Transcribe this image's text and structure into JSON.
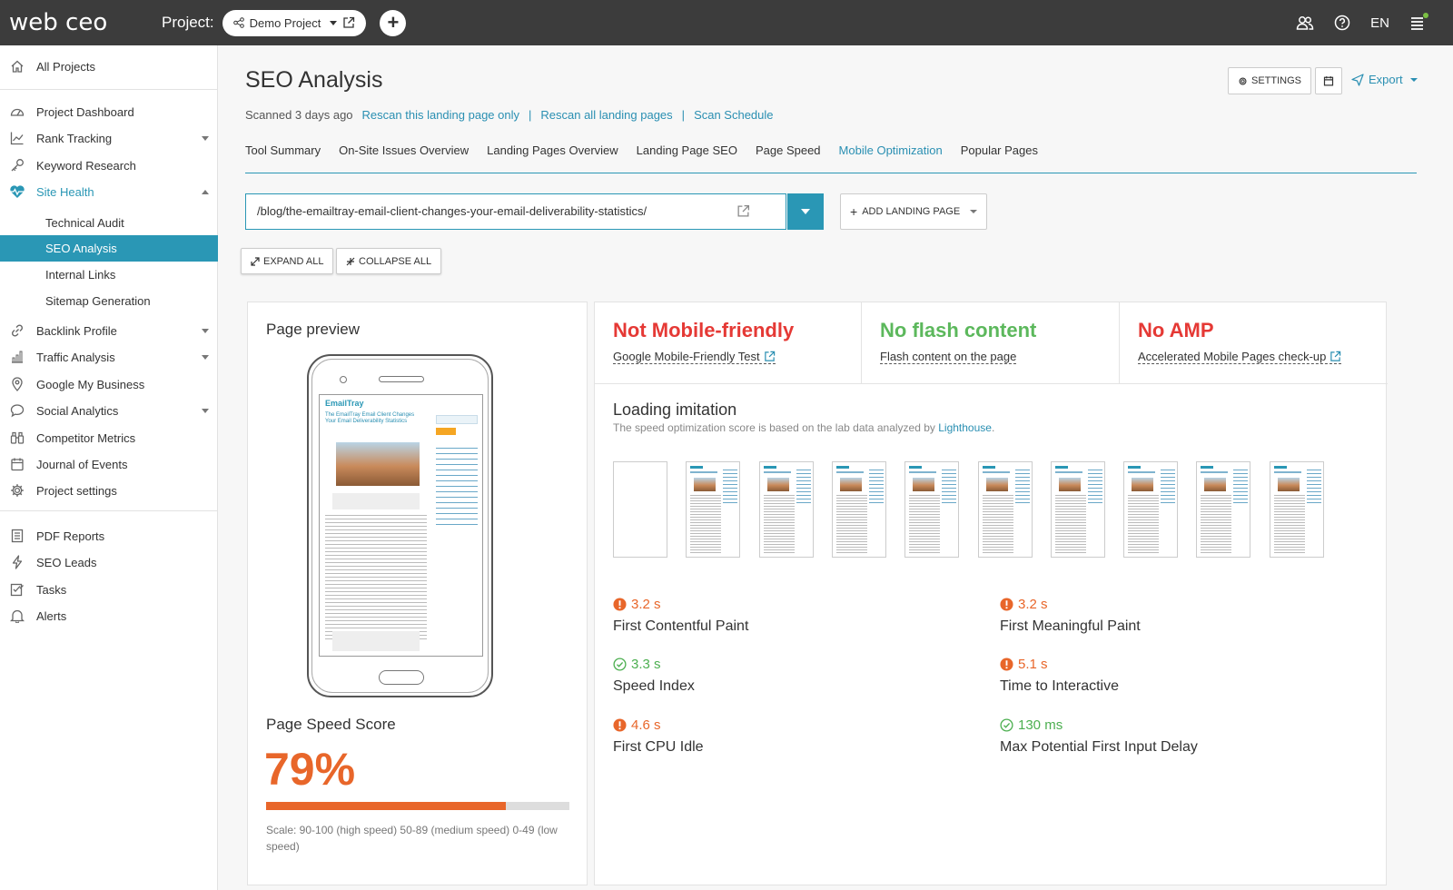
{
  "app": {
    "logo": "web ceo",
    "project_label": "Project:",
    "project_name": "Demo Project",
    "lang": "EN"
  },
  "sidebar": {
    "all_projects": "All Projects",
    "items": [
      {
        "label": "Project Dashboard",
        "icon": "gauge-icon"
      },
      {
        "label": "Rank Tracking",
        "icon": "chart-line-icon"
      },
      {
        "label": "Keyword Research",
        "icon": "key-icon"
      },
      {
        "label": "Site Health",
        "icon": "heartbeat-icon"
      },
      {
        "label": "Technical Audit"
      },
      {
        "label": "SEO Analysis"
      },
      {
        "label": "Internal Links"
      },
      {
        "label": "Sitemap Generation"
      },
      {
        "label": "Backlink Profile",
        "icon": "link-icon"
      },
      {
        "label": "Traffic Analysis",
        "icon": "bar-chart-icon"
      },
      {
        "label": "Google My Business",
        "icon": "map-pin-icon"
      },
      {
        "label": "Social Analytics",
        "icon": "chat-bubble-icon"
      },
      {
        "label": "Competitor Metrics",
        "icon": "binoculars-icon"
      },
      {
        "label": "Journal of Events",
        "icon": "calendar-icon"
      },
      {
        "label": "Project settings",
        "icon": "gear-icon"
      },
      {
        "label": "PDF Reports",
        "icon": "document-icon"
      },
      {
        "label": "SEO Leads",
        "icon": "lightning-icon"
      },
      {
        "label": "Tasks",
        "icon": "checklist-icon"
      },
      {
        "label": "Alerts",
        "icon": "bell-icon"
      }
    ]
  },
  "header": {
    "title": "SEO Analysis",
    "scanned": "Scanned 3 days ago",
    "rescan_page": "Rescan this landing page only",
    "rescan_all": "Rescan all landing pages",
    "scan_schedule": "Scan Schedule",
    "settings_label": "SETTINGS",
    "export_label": "Export"
  },
  "tabs": [
    "Tool Summary",
    "On-Site Issues Overview",
    "Landing Pages Overview",
    "Landing Page SEO",
    "Page Speed",
    "Mobile Optimization",
    "Popular Pages"
  ],
  "active_tab": "Mobile Optimization",
  "url_input": "/blog/the-emailtray-email-client-changes-your-email-deliverability-statistics/",
  "add_landing_label": "ADD LANDING PAGE",
  "expand_all": "EXPAND ALL",
  "collapse_all": "COLLAPSE ALL",
  "preview": {
    "title": "Page preview",
    "screen": {
      "brand": "EmailTray",
      "headline": "The EmailTray Email Client Changes Your Email Deliverability Statistics"
    },
    "speed_title": "Page Speed Score",
    "speed_score": "79%",
    "speed_value": 0.79,
    "scale": "Scale: 90-100 (high speed) 50-89 (medium speed) 0-49 (low speed)"
  },
  "status": [
    {
      "title": "Not Mobile-friendly",
      "sub": "Google Mobile-Friendly Test",
      "color": "#e53935",
      "external": true
    },
    {
      "title": "No flash content",
      "sub": "Flash content on the page",
      "color": "#5cb85c",
      "external": false
    },
    {
      "title": "No AMP",
      "sub": "Accelerated Mobile Pages check-up",
      "color": "#e53935",
      "external": true
    }
  ],
  "loading": {
    "title": "Loading imitation",
    "desc": "The speed optimization score is based on the lab data analyzed by ",
    "link": "Lighthouse",
    "desc_end": "."
  },
  "metrics": [
    {
      "value": "3.2 s",
      "name": "First Contentful Paint",
      "status": "bad"
    },
    {
      "value": "3.2 s",
      "name": "First Meaningful Paint",
      "status": "bad"
    },
    {
      "value": "3.3 s",
      "name": "Speed Index",
      "status": "good"
    },
    {
      "value": "5.1 s",
      "name": "Time to Interactive",
      "status": "bad"
    },
    {
      "value": "4.6 s",
      "name": "First CPU Idle",
      "status": "bad"
    },
    {
      "value": "130 ms",
      "name": "Max Potential First Input Delay",
      "status": "good"
    }
  ],
  "colors": {
    "accent": "#2a97b5",
    "orange": "#e8662a",
    "red": "#e53935",
    "green": "#5cb85c",
    "topbar": "#3c3c3c"
  }
}
